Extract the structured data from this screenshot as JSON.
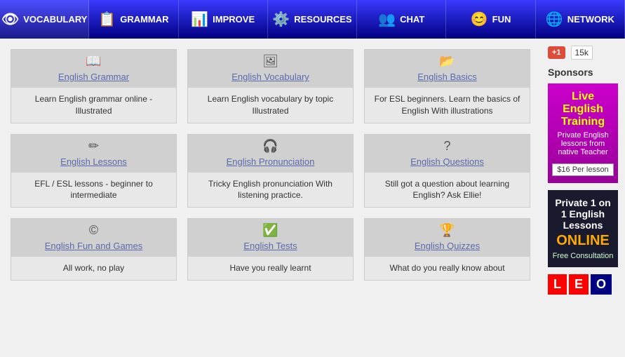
{
  "nav": {
    "items": [
      {
        "label": "VOCABULARY",
        "icon": "👁"
      },
      {
        "label": "GRAMMAR",
        "icon": "📋"
      },
      {
        "label": "IMPROVE",
        "icon": "📊"
      },
      {
        "label": "RESOURCES",
        "icon": "⚙️"
      },
      {
        "label": "CHAT",
        "icon": "👥"
      },
      {
        "label": "FUN",
        "icon": "😊"
      },
      {
        "label": "NETWORK",
        "icon": "🌐"
      }
    ]
  },
  "cards": {
    "row1": [
      {
        "icon": "📖",
        "title": "English Grammar",
        "desc": "Learn English grammar online - Illustrated"
      },
      {
        "icon": "🖼",
        "title": "English Vocabulary",
        "desc": "Learn English vocabulary by topic Illustrated"
      },
      {
        "icon": "📂",
        "title": "English Basics",
        "desc": "For ESL beginners. Learn the basics of English With illustrations"
      }
    ],
    "row2": [
      {
        "icon": "✏",
        "title": "English Lessons",
        "desc": "EFL / ESL lessons - beginner to intermediate"
      },
      {
        "icon": "🎧",
        "title": "English Pronunciation",
        "desc": "Tricky English pronunciation With listening practice."
      },
      {
        "icon": "?",
        "title": "English Questions",
        "desc": "Still got a question about learning English? Ask Ellie!"
      }
    ],
    "row3": [
      {
        "icon": "©",
        "title": "English Fun and Games",
        "desc": "All work, no play"
      },
      {
        "icon": "✅",
        "title": "English Tests",
        "desc": "Have you really learnt"
      },
      {
        "icon": "🏆",
        "title": "English Quizzes",
        "desc": "What do you really know about"
      }
    ]
  },
  "sidebar": {
    "gplus_label": "+1",
    "gplus_count": "15k",
    "sponsors_title": "Sponsors",
    "ad1": {
      "title": "Live English Training",
      "subtitle": "Private English lessons from native Teacher",
      "price": "$16 Per lesson"
    },
    "ad2": {
      "title": "Private 1 on 1 English Lessons",
      "online": "ONLINE",
      "consult": "Free Consultation"
    },
    "leo": [
      "L",
      "E",
      "O"
    ]
  }
}
